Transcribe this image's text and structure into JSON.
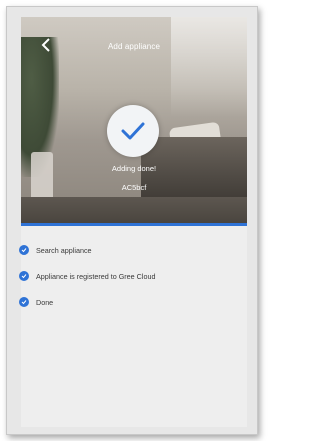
{
  "header": {
    "title": "Add appliance",
    "back_icon": "chevron-left-icon"
  },
  "status": {
    "message": "Adding done!",
    "device_name": "AC5bcf",
    "icon": "check-icon"
  },
  "progress": {
    "fraction": 1.0,
    "color": "#2f73d6"
  },
  "steps": [
    {
      "label": "Search appliance",
      "done": true
    },
    {
      "label": "Appliance is registered to Gree Cloud",
      "done": true
    },
    {
      "label": "Done",
      "done": true
    }
  ],
  "colors": {
    "accent": "#2f73d6",
    "check": "#2f73d6"
  }
}
